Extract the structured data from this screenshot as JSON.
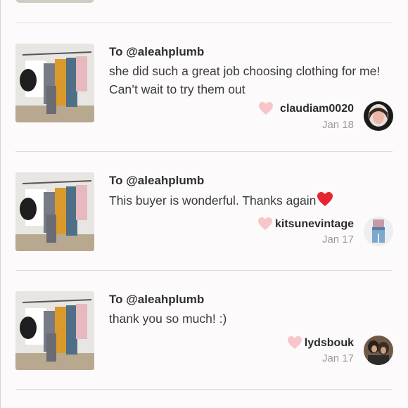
{
  "colors": {
    "heart": "#f8c5c8",
    "heart_emoji": "#e8242f",
    "divider": "#dcdcdc",
    "date": "#9a9a9a"
  },
  "reviews": [
    {
      "to": "To @aleahplumb",
      "message": "she did such a great job choosing clothing for me! Can’t wait to try them out",
      "emoji": "",
      "username": "claudiam0020",
      "date": "Jan 18",
      "icon": "heart-icon"
    },
    {
      "to": "To @aleahplumb",
      "message": "This buyer is wonderful. Thanks again",
      "emoji": "heart-emoji",
      "username": "kitsunevintage",
      "date": "Jan 17",
      "icon": "heart-icon"
    },
    {
      "to": "To @aleahplumb",
      "message": "thank you so much! :)",
      "emoji": "",
      "username": "lydsbouk",
      "date": "Jan 17",
      "icon": "heart-icon"
    }
  ]
}
